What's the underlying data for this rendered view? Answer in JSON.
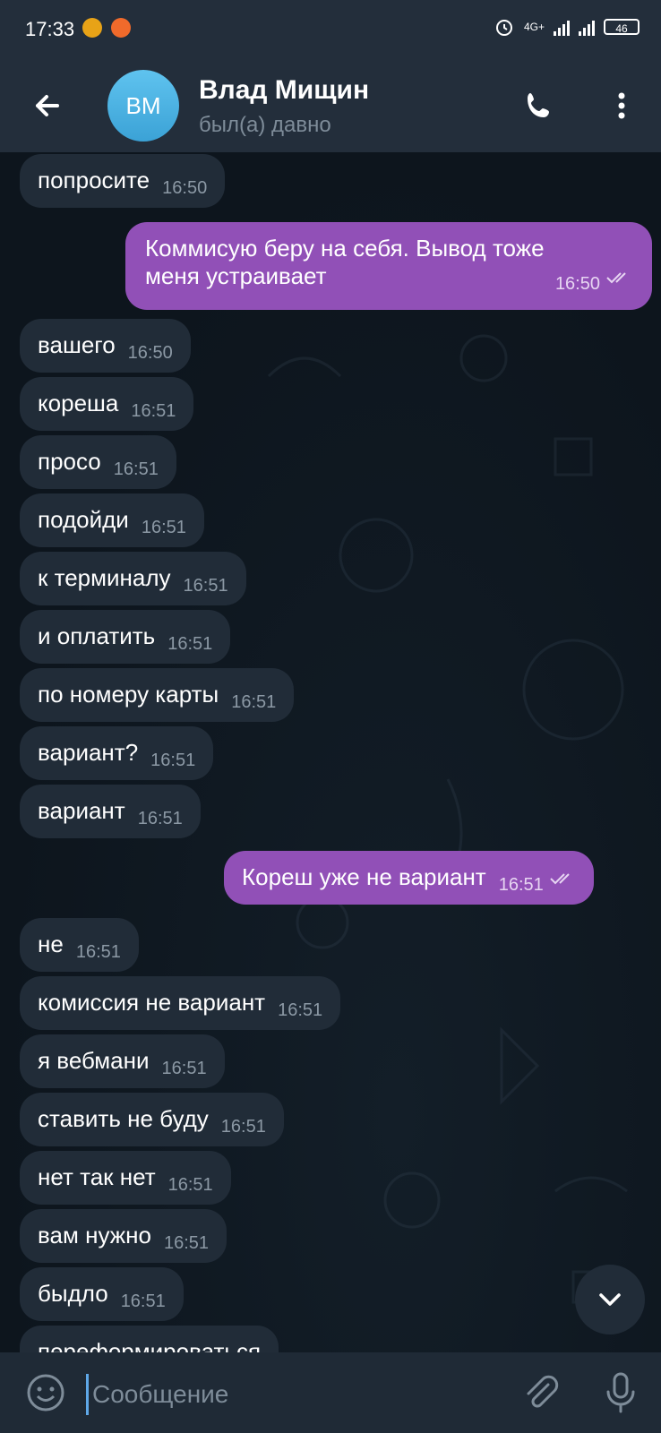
{
  "status_bar": {
    "time": "17:33",
    "network": "4G+",
    "battery": "46"
  },
  "header": {
    "back_icon": "arrow-left-icon",
    "avatar_initials": "ВМ",
    "contact_name": "Влад Мищин",
    "contact_status": "был(а) давно",
    "call_icon": "phone-icon",
    "more_icon": "dots-vertical-icon"
  },
  "messages": [
    {
      "dir": "in",
      "text": "попросите",
      "time": "16:50"
    },
    {
      "dir": "out",
      "line1": "Коммисую беру на себя. Вывод тоже",
      "line2": "меня устраивает",
      "time": "16:50"
    },
    {
      "dir": "in",
      "text": "вашего",
      "time": "16:50"
    },
    {
      "dir": "in",
      "text": "кореша",
      "time": "16:51"
    },
    {
      "dir": "in",
      "text": "просо",
      "time": "16:51"
    },
    {
      "dir": "in",
      "text": "подойди",
      "time": "16:51"
    },
    {
      "dir": "in",
      "text": "к терминалу",
      "time": "16:51"
    },
    {
      "dir": "in",
      "text": "и оплатить",
      "time": "16:51"
    },
    {
      "dir": "in",
      "text": "по номеру карты",
      "time": "16:51"
    },
    {
      "dir": "in",
      "text": "вариант?",
      "time": "16:51"
    },
    {
      "dir": "in",
      "text": "вариант",
      "time": "16:51"
    },
    {
      "dir": "out",
      "text": "Кореш уже не вариант",
      "time": "16:51"
    },
    {
      "dir": "in",
      "text": "не",
      "time": "16:51"
    },
    {
      "dir": "in",
      "text": "комиссия не вариант",
      "time": "16:51"
    },
    {
      "dir": "in",
      "text": "я вебмани",
      "time": "16:51"
    },
    {
      "dir": "in",
      "text": "ставить не буду",
      "time": "16:51"
    },
    {
      "dir": "in",
      "text": "нет так нет",
      "time": "16:51"
    },
    {
      "dir": "in",
      "text": "вам нужно",
      "time": "16:51"
    },
    {
      "dir": "in",
      "text": "быдло",
      "time": "16:51"
    },
    {
      "dir": "in",
      "text": "переформироваться"
    }
  ],
  "input": {
    "placeholder": "Сообщение",
    "value": ""
  },
  "colors": {
    "header_bg": "#232e3b",
    "incoming_bubble": "#212c38",
    "outgoing_bubble": "#9150b7",
    "chat_bg": "#0f1820",
    "accent": "#5fa8e8"
  }
}
